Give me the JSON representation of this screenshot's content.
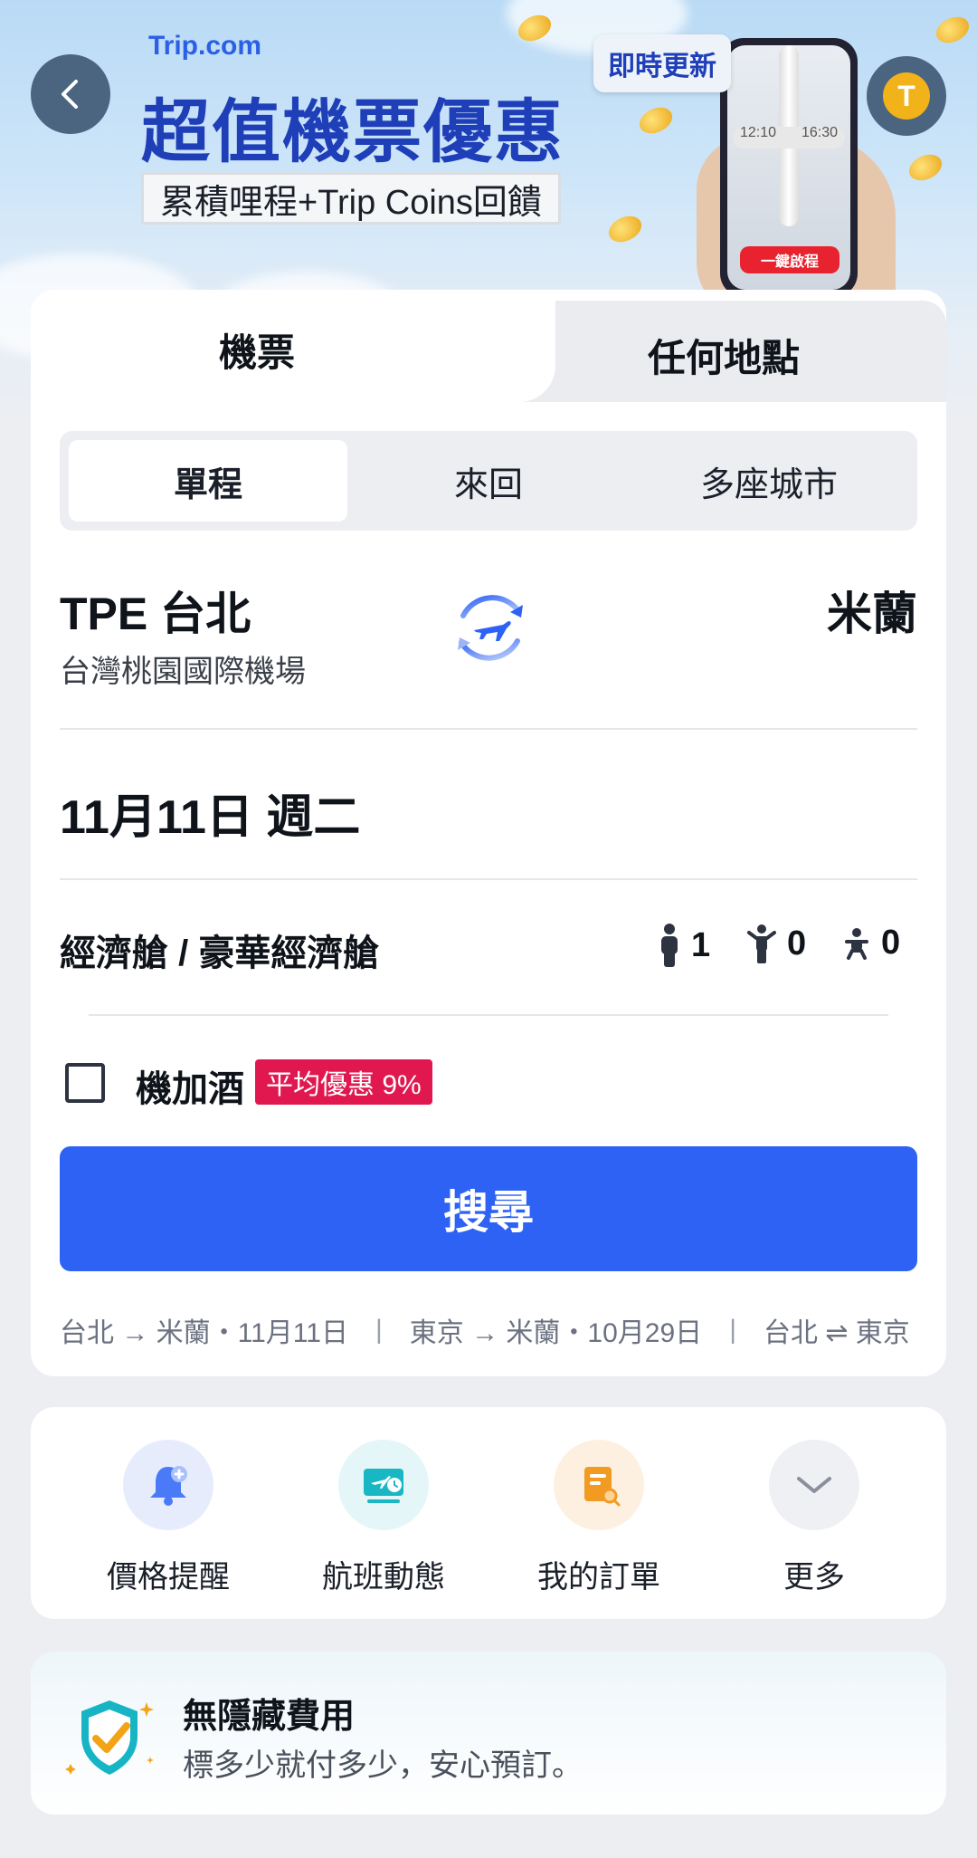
{
  "banner": {
    "brand": "Trip.com",
    "headline": "超值機票優惠",
    "subtag": "累積哩程+Trip Coins回饋",
    "bubble": "即時更新",
    "phone_time_left": "12:10",
    "phone_time_right": "16:30",
    "phone_button": "一鍵啟程",
    "avatar_letter": "T"
  },
  "main_tabs": [
    {
      "label": "機票",
      "active": true
    },
    {
      "label": "任何地點",
      "active": false
    }
  ],
  "trip_types": [
    {
      "label": "單程",
      "active": true
    },
    {
      "label": "來回",
      "active": false
    },
    {
      "label": "多座城市",
      "active": false
    }
  ],
  "route": {
    "from": "TPE 台北",
    "from_airport": "台灣桃園國際機場",
    "to": "米蘭"
  },
  "date": "11月11日 週二",
  "cabin": "經濟艙 / 豪華經濟艙",
  "passengers": {
    "adult": "1",
    "child": "0",
    "infant": "0"
  },
  "hotel_addon": {
    "label": "機加酒",
    "badge": "平均優惠 9%"
  },
  "search_label": "搜尋",
  "history": [
    "台北 → 米蘭・11月11日",
    "東京 → 米蘭・10月29日",
    "台北 ⇌ 東京"
  ],
  "tools": [
    {
      "label": "價格提醒",
      "icon": "bell-icon"
    },
    {
      "label": "航班動態",
      "icon": "flight-status-icon"
    },
    {
      "label": "我的訂單",
      "icon": "orders-icon"
    },
    {
      "label": "更多",
      "icon": "chevron-down-icon"
    }
  ],
  "fee": {
    "title": "無隱藏費用",
    "subtitle": "標多少就付多少，安心預訂。"
  },
  "colors": {
    "primary": "#2d62f5",
    "badge": "#e0184f",
    "headline": "#1f3fb8"
  }
}
